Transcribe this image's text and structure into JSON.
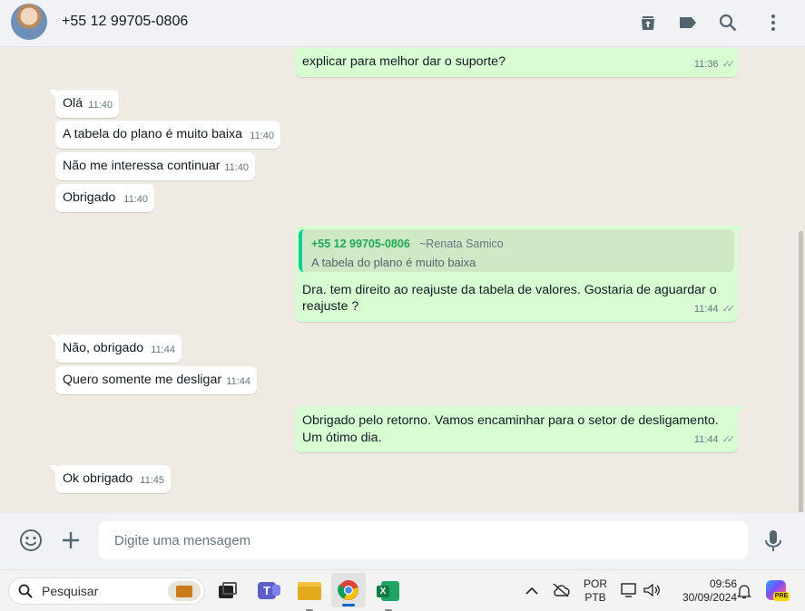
{
  "header": {
    "contact": "+55 12 99705-0806",
    "icons": [
      "archive-icon",
      "label-icon",
      "search-icon",
      "menu-icon"
    ]
  },
  "messages": {
    "m0": {
      "text": "explicar para melhor dar o suporte?",
      "time": "11:36",
      "direction": "out"
    },
    "m1": {
      "text": "Olá",
      "time": "11:40",
      "direction": "in"
    },
    "m2": {
      "text": "A tabela do plano é muito baixa",
      "time": "11:40",
      "direction": "in"
    },
    "m3": {
      "text": "Não me interessa continuar",
      "time": "11:40",
      "direction": "in"
    },
    "m4": {
      "text": "Obrigado",
      "time": "11:40",
      "direction": "in"
    },
    "m5": {
      "quote_author": "+55 12 99705-0806",
      "quote_name": "~Renata Samico",
      "quote_text": "A tabela do plano é muito baixa",
      "text_line1": "Dra. tem direito ao reajuste da tabela de valores. Gostaria de aguardar o",
      "text_line2": "reajuste ?",
      "time": "11:44",
      "direction": "out"
    },
    "m6": {
      "text": "Não, obrigado",
      "time": "11:44",
      "direction": "in"
    },
    "m7": {
      "text": "Quero somente me desligar",
      "time": "11:44",
      "direction": "in"
    },
    "m8": {
      "text_line1": "Obrigado pelo retorno. Vamos encaminhar para o setor de desligamento.",
      "text_line2": "Um ótimo dia.",
      "time": "11:44",
      "direction": "out"
    },
    "m9": {
      "text": "Ok obrigado",
      "time": "11:45",
      "direction": "in"
    }
  },
  "composer": {
    "placeholder": "Digite uma mensagem",
    "icons": [
      "emoji-icon",
      "plus-icon",
      "microphone-icon"
    ]
  },
  "taskbar": {
    "search_label": "Pesquisar",
    "lang_line1": "POR",
    "lang_line2": "PTB",
    "time": "09:56",
    "date": "30/09/2024",
    "copilot_badge": "PRE",
    "colors": {
      "accent_green": "#06cf9c",
      "out_bubble": "#d9fdd3",
      "quote_author": "#1fa855"
    }
  }
}
